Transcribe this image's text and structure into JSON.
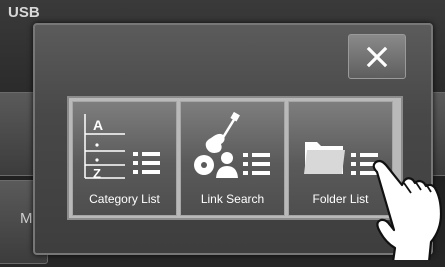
{
  "background": {
    "source_label": "USB",
    "partial_letter": "M"
  },
  "popup": {
    "close_label": "×",
    "options": [
      {
        "label": "Category List",
        "icon": "category-list-icon"
      },
      {
        "label": "Link Search",
        "icon": "link-search-icon"
      },
      {
        "label": "Folder List",
        "icon": "folder-list-icon"
      }
    ]
  },
  "colors": {
    "popup_bg": "#4a4a4a",
    "button_bg": "#6c6c6c",
    "text": "#ffffff"
  }
}
